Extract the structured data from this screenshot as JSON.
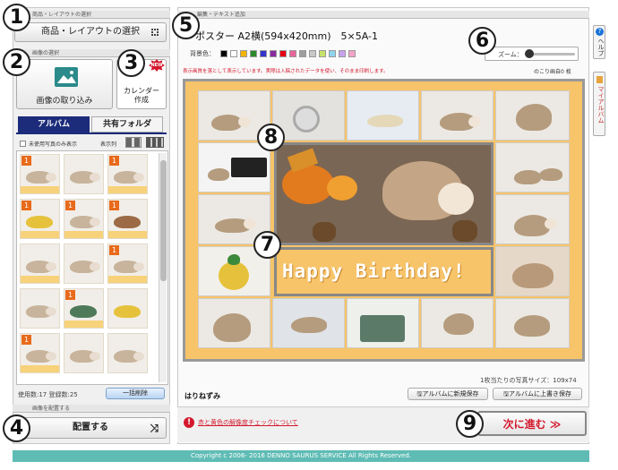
{
  "circles": [
    "1",
    "2",
    "3",
    "4",
    "5",
    "6",
    "7",
    "8",
    "9"
  ],
  "left": {
    "sec1_label": "商品・レイアウトの選択",
    "select_btn": "商品・レイアウトの選択",
    "sec2_label": "画像の選択",
    "import_label": "画像の取り込み",
    "calendar_label": "カレンダー\n作成",
    "new_badge": "NEW",
    "tab_album": "アルバム",
    "tab_shared": "共有フォルダ",
    "unused_only": "未使用写真のみ表示",
    "display_cols": "表示列",
    "count_text": "使用数:17 登録数:25",
    "bulk_delete": "一括削除",
    "sec4_label": "画像を配置する",
    "place_btn": "配置する",
    "thumb_badge": "1"
  },
  "editor": {
    "sec_label": "編集・テキスト追加",
    "product_title": "ポスター A2横(594x420mm)　5×5A-1",
    "bg_label": "背景色：",
    "bg_colors": [
      "#000000",
      "#ffffff",
      "#f2b400",
      "#2a8a2a",
      "#3333cc",
      "#8a2aa0",
      "#e60012",
      "#e8669c",
      "#9e9e9e",
      "#c8c8c8",
      "#c6e26b",
      "#8ed3ef",
      "#c8a2ee",
      "#f5a3c8"
    ],
    "zoom_label": "ズーム：",
    "warning": "表示画質を落として表示しています。実際は入稿されたデータを使い、そのまま印刷します。",
    "remaining": "のこり画自0 枚",
    "canvas_bg": "#f7c46a",
    "birthday_text": "Happy Birthday!",
    "size_text": "1枚当たりの写真サイズ：109x74",
    "album_name": "はりねずみ",
    "save_new": "アルバムに新規保存",
    "save_overwrite": "アルバムに上書き保存",
    "check_link": "赤と黄色の解像度チェックについて",
    "next_btn": "次に進む ≫"
  },
  "side": {
    "help": "ヘルプ",
    "my_album": "マイアルバム"
  },
  "footer": "Copyright c 2006- 2016 DENNO SAURUS SERVICE All Rights Reserved."
}
